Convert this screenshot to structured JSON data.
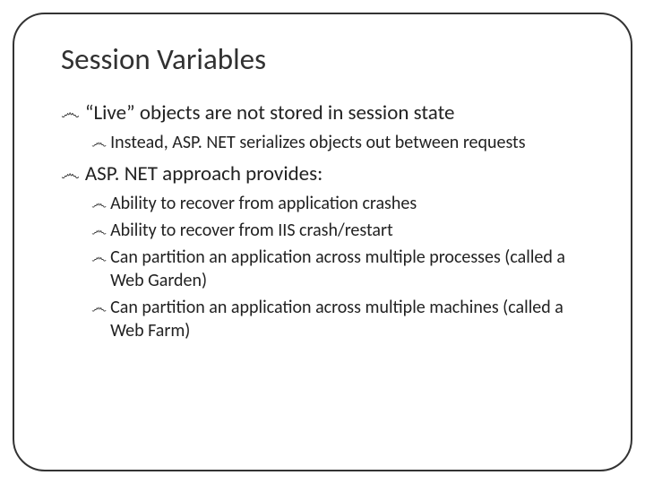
{
  "slide": {
    "title": "Session Variables",
    "bullets": [
      {
        "text": "“Live” objects are not stored in session state",
        "children": [
          {
            "text": "Instead, ASP. NET serializes objects out between requests"
          }
        ]
      },
      {
        "text": "ASP. NET approach provides:",
        "children": [
          {
            "text": "Ability to recover from application crashes"
          },
          {
            "text": "Ability to recover from IIS crash/restart"
          },
          {
            "text": "Can partition an application across multiple processes (called a Web Garden)"
          },
          {
            "text": "Can partition an application across multiple machines (called a Web Farm)"
          }
        ]
      }
    ],
    "bullet_glyph": "෴"
  }
}
